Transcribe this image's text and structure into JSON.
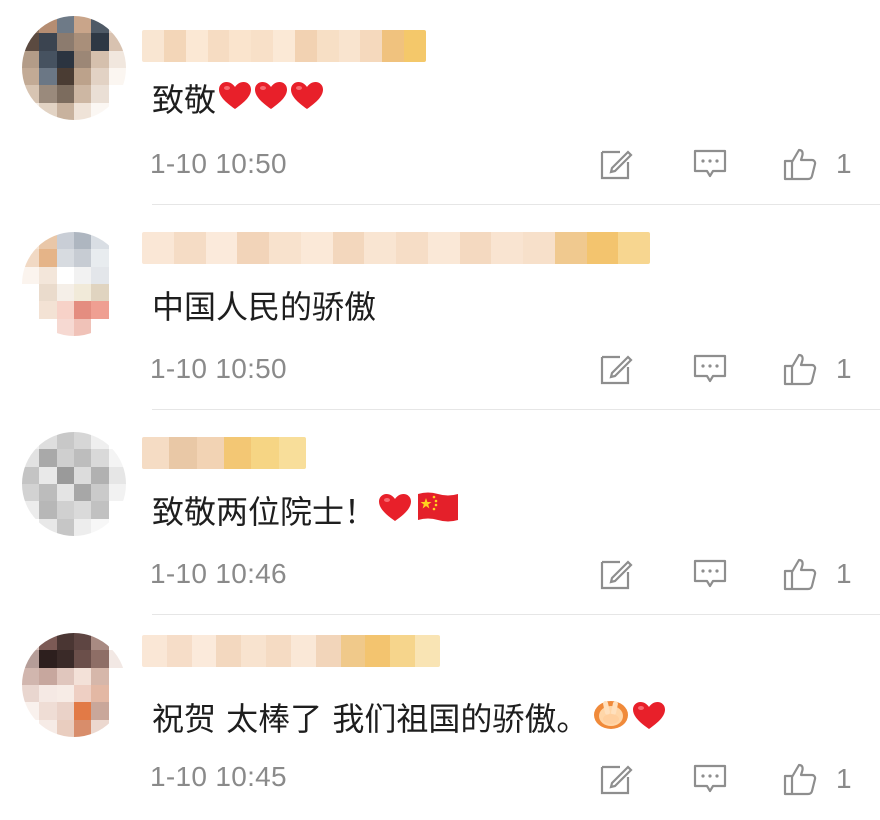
{
  "comments": [
    {
      "text": "致敬",
      "emojis": [
        "heart",
        "heart",
        "heart"
      ],
      "time": "1-10 10:50",
      "likes": "1",
      "avatar_colors": [
        "#8a6f5a",
        "#b58d72",
        "#6e7a87",
        "#c9a58a",
        "#4f5a66",
        "#e7d4c6",
        "#5b4a40",
        "#3b4450",
        "#8c7b6e",
        "#a98f7a",
        "#2e3844",
        "#d8c2b0",
        "#b39c88",
        "#465260",
        "#2b3440",
        "#9c8776",
        "#d5c0ad",
        "#f1e7de",
        "#c2aa95",
        "#6b7785",
        "#4a3c33",
        "#bca28b",
        "#e2d2c4",
        "#fbf6f1",
        "#d7c4b2",
        "#9a8a7c",
        "#7c6c5e",
        "#cdb7a3",
        "#eadfd5",
        "#ffffff",
        "#f4ece4",
        "#e2d3c4",
        "#c8b29e",
        "#efe3d8",
        "#fbf7f3",
        "#ffffff"
      ],
      "username_colors": [
        "#f9e6d2",
        "#f3d6b8",
        "#fbe8d4",
        "#f6dcc2",
        "#fae4cd",
        "#f8e0c8",
        "#fbe9d6",
        "#f2d2b2",
        "#f7dfc5",
        "#f9e4cf",
        "#f5d9bd",
        "#f0c27e",
        "#f4c86a"
      ]
    },
    {
      "text": "中国人民的骄傲",
      "emojis": [],
      "time": "1-10 10:50",
      "likes": "1",
      "avatar_colors": [
        "#f7e3d1",
        "#e9c7a8",
        "#c9ced6",
        "#aeb6c0",
        "#d9dee4",
        "#ffffff",
        "#f1d9c4",
        "#e5b488",
        "#d7dbe0",
        "#c7ccd3",
        "#e8ecef",
        "#ffffff",
        "#fbf4ee",
        "#f3e6da",
        "#ffffff",
        "#f2f2f2",
        "#e3e6ea",
        "#ffffff",
        "#ffffff",
        "#eadbcc",
        "#f5efe8",
        "#f1ead9",
        "#e0d4c0",
        "#ffffff",
        "#ffffff",
        "#f3e2d4",
        "#f7d2c8",
        "#e48d80",
        "#ef9f92",
        "#ffffff",
        "#ffffff",
        "#ffffff",
        "#f6d9d2",
        "#f0c2b8",
        "#ffffff",
        "#ffffff"
      ],
      "username_colors": [
        "#fae7d6",
        "#f5dcc5",
        "#fbeadb",
        "#f2d4b9",
        "#f8e2cd",
        "#fbe9d8",
        "#f3d7bd",
        "#f9e5d2",
        "#f6ddc6",
        "#fae8d7",
        "#f4d9c0",
        "#f9e4d1",
        "#f7e0ca",
        "#f0c98f",
        "#f3c46e",
        "#f7d690"
      ]
    },
    {
      "text": "致敬两位院士！",
      "emojis": [
        "heart",
        "flag"
      ],
      "time": "1-10 10:46",
      "likes": "1",
      "avatar_colors": [
        "#f0f0f0",
        "#dedede",
        "#c8c8c8",
        "#d6d6d6",
        "#efefef",
        "#ffffff",
        "#e2e2e2",
        "#a9a9a9",
        "#cfcfcf",
        "#bdbdbd",
        "#d9d9d9",
        "#f4f4f4",
        "#c4c4c4",
        "#e9e9e9",
        "#9a9a9a",
        "#dcdcdc",
        "#b1b1b1",
        "#e6e6e6",
        "#d2d2d2",
        "#bcbcbc",
        "#e4e4e4",
        "#a7a7a7",
        "#cacaca",
        "#f2f2f2",
        "#ececec",
        "#b7b7b7",
        "#d0d0d0",
        "#dadada",
        "#c1c1c1",
        "#ffffff",
        "#ffffff",
        "#e8e8e8",
        "#c6c6c6",
        "#ededed",
        "#f7f7f7",
        "#ffffff"
      ],
      "username_colors": [
        "#f5dcc4",
        "#e9c8a6",
        "#f2d3b4",
        "#f3c774",
        "#f6d584",
        "#f8de9a"
      ]
    },
    {
      "text": "祝贺 太棒了 我们祖国的骄傲。",
      "emojis": [
        "hand",
        "heart"
      ],
      "time": "1-10 10:45",
      "likes": "1",
      "avatar_colors": [
        "#d9c3bd",
        "#7c5a55",
        "#4a3633",
        "#5e4542",
        "#a88a82",
        "#ffffff",
        "#b59d98",
        "#2d1f1e",
        "#3a2a28",
        "#6b4f4a",
        "#8e6e66",
        "#f2e8e4",
        "#d1b6ae",
        "#c7a79e",
        "#e0c6bd",
        "#f3e1d8",
        "#d6b7aa",
        "#ffffff",
        "#e9d6cf",
        "#f5e9e4",
        "#f7ece6",
        "#eecfc3",
        "#e3b8a4",
        "#ffffff",
        "#f9f1ed",
        "#efddd5",
        "#ead2c8",
        "#e27a46",
        "#c9a79a",
        "#ffffff",
        "#ffffff",
        "#f6ebe6",
        "#e9cdbf",
        "#d88d6b",
        "#ecd8cf",
        "#ffffff"
      ],
      "username_colors": [
        "#fae7d6",
        "#f6ddc8",
        "#fbeadb",
        "#f3d8bf",
        "#f8e3cf",
        "#f5dbc3",
        "#fae8d7",
        "#f2d5ba",
        "#f0c98a",
        "#f3c46f",
        "#f6d58c",
        "#f9e4b4"
      ]
    }
  ],
  "icons": {
    "edit": "edit-square-icon",
    "reply": "comment-bubble-icon",
    "like": "thumbs-up-icon"
  },
  "colors": {
    "meta_text": "#8a8a8a",
    "icon_stroke": "#8e8e8e",
    "heart": "#e8202a",
    "divider": "#e6e6e6"
  }
}
